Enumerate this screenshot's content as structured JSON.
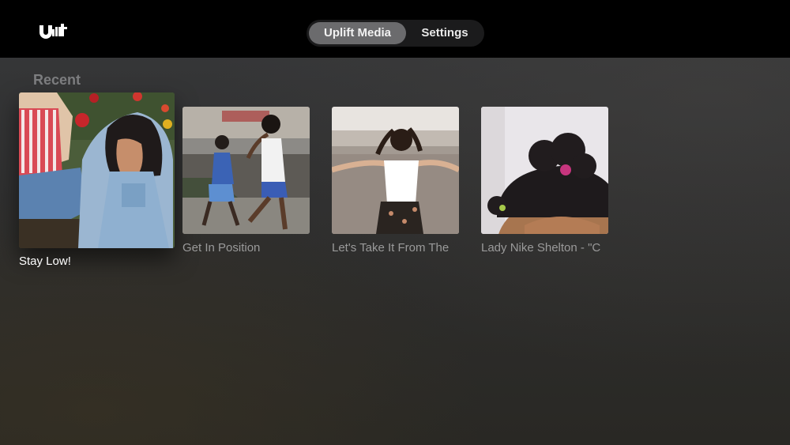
{
  "header": {
    "logo_icon": "uplift-logo-icon",
    "tabs": [
      {
        "label": "Uplift Media",
        "active": true
      },
      {
        "label": "Settings",
        "active": false
      }
    ]
  },
  "recent": {
    "title": "Recent",
    "items": [
      {
        "caption": "Stay Low!",
        "focused": true,
        "image": "two-women-sitting-by-flowers"
      },
      {
        "caption": "Get In Position",
        "focused": false,
        "image": "two-children-running"
      },
      {
        "caption": "Let's Take It From The",
        "focused": false,
        "image": "girl-arms-outstretched-over-city"
      },
      {
        "caption": "Lady Nike Shelton - \"C",
        "focused": false,
        "image": "child-hair-puffs-closeup"
      }
    ]
  },
  "colors": {
    "topbar": "#000000",
    "tab_active": "#6b6b6d",
    "tab_container": "#1b1b1c",
    "section_title": "#7d7e80",
    "caption": "#9a9a9a",
    "caption_focused": "#ffffff"
  }
}
